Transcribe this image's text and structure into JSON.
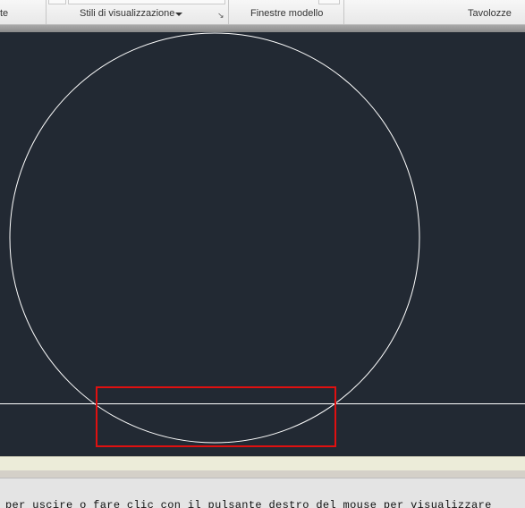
{
  "ribbon": {
    "panels": [
      {
        "label": "te"
      },
      {
        "label": "Stili di visualizzazione"
      },
      {
        "label": "Finestre modello"
      },
      {
        "label": "Tavolozze"
      }
    ],
    "launcher_icon": "dialog-launcher-icon",
    "dropdown_icon": "dropdown-arrow-icon"
  },
  "drawing": {
    "background": "#222933",
    "entity_color": "#ffffff",
    "highlight_color": "#e01010"
  },
  "command_line": {
    "text": "per uscire o fare clic con il pulsante destro del mouse per visualizzare"
  }
}
